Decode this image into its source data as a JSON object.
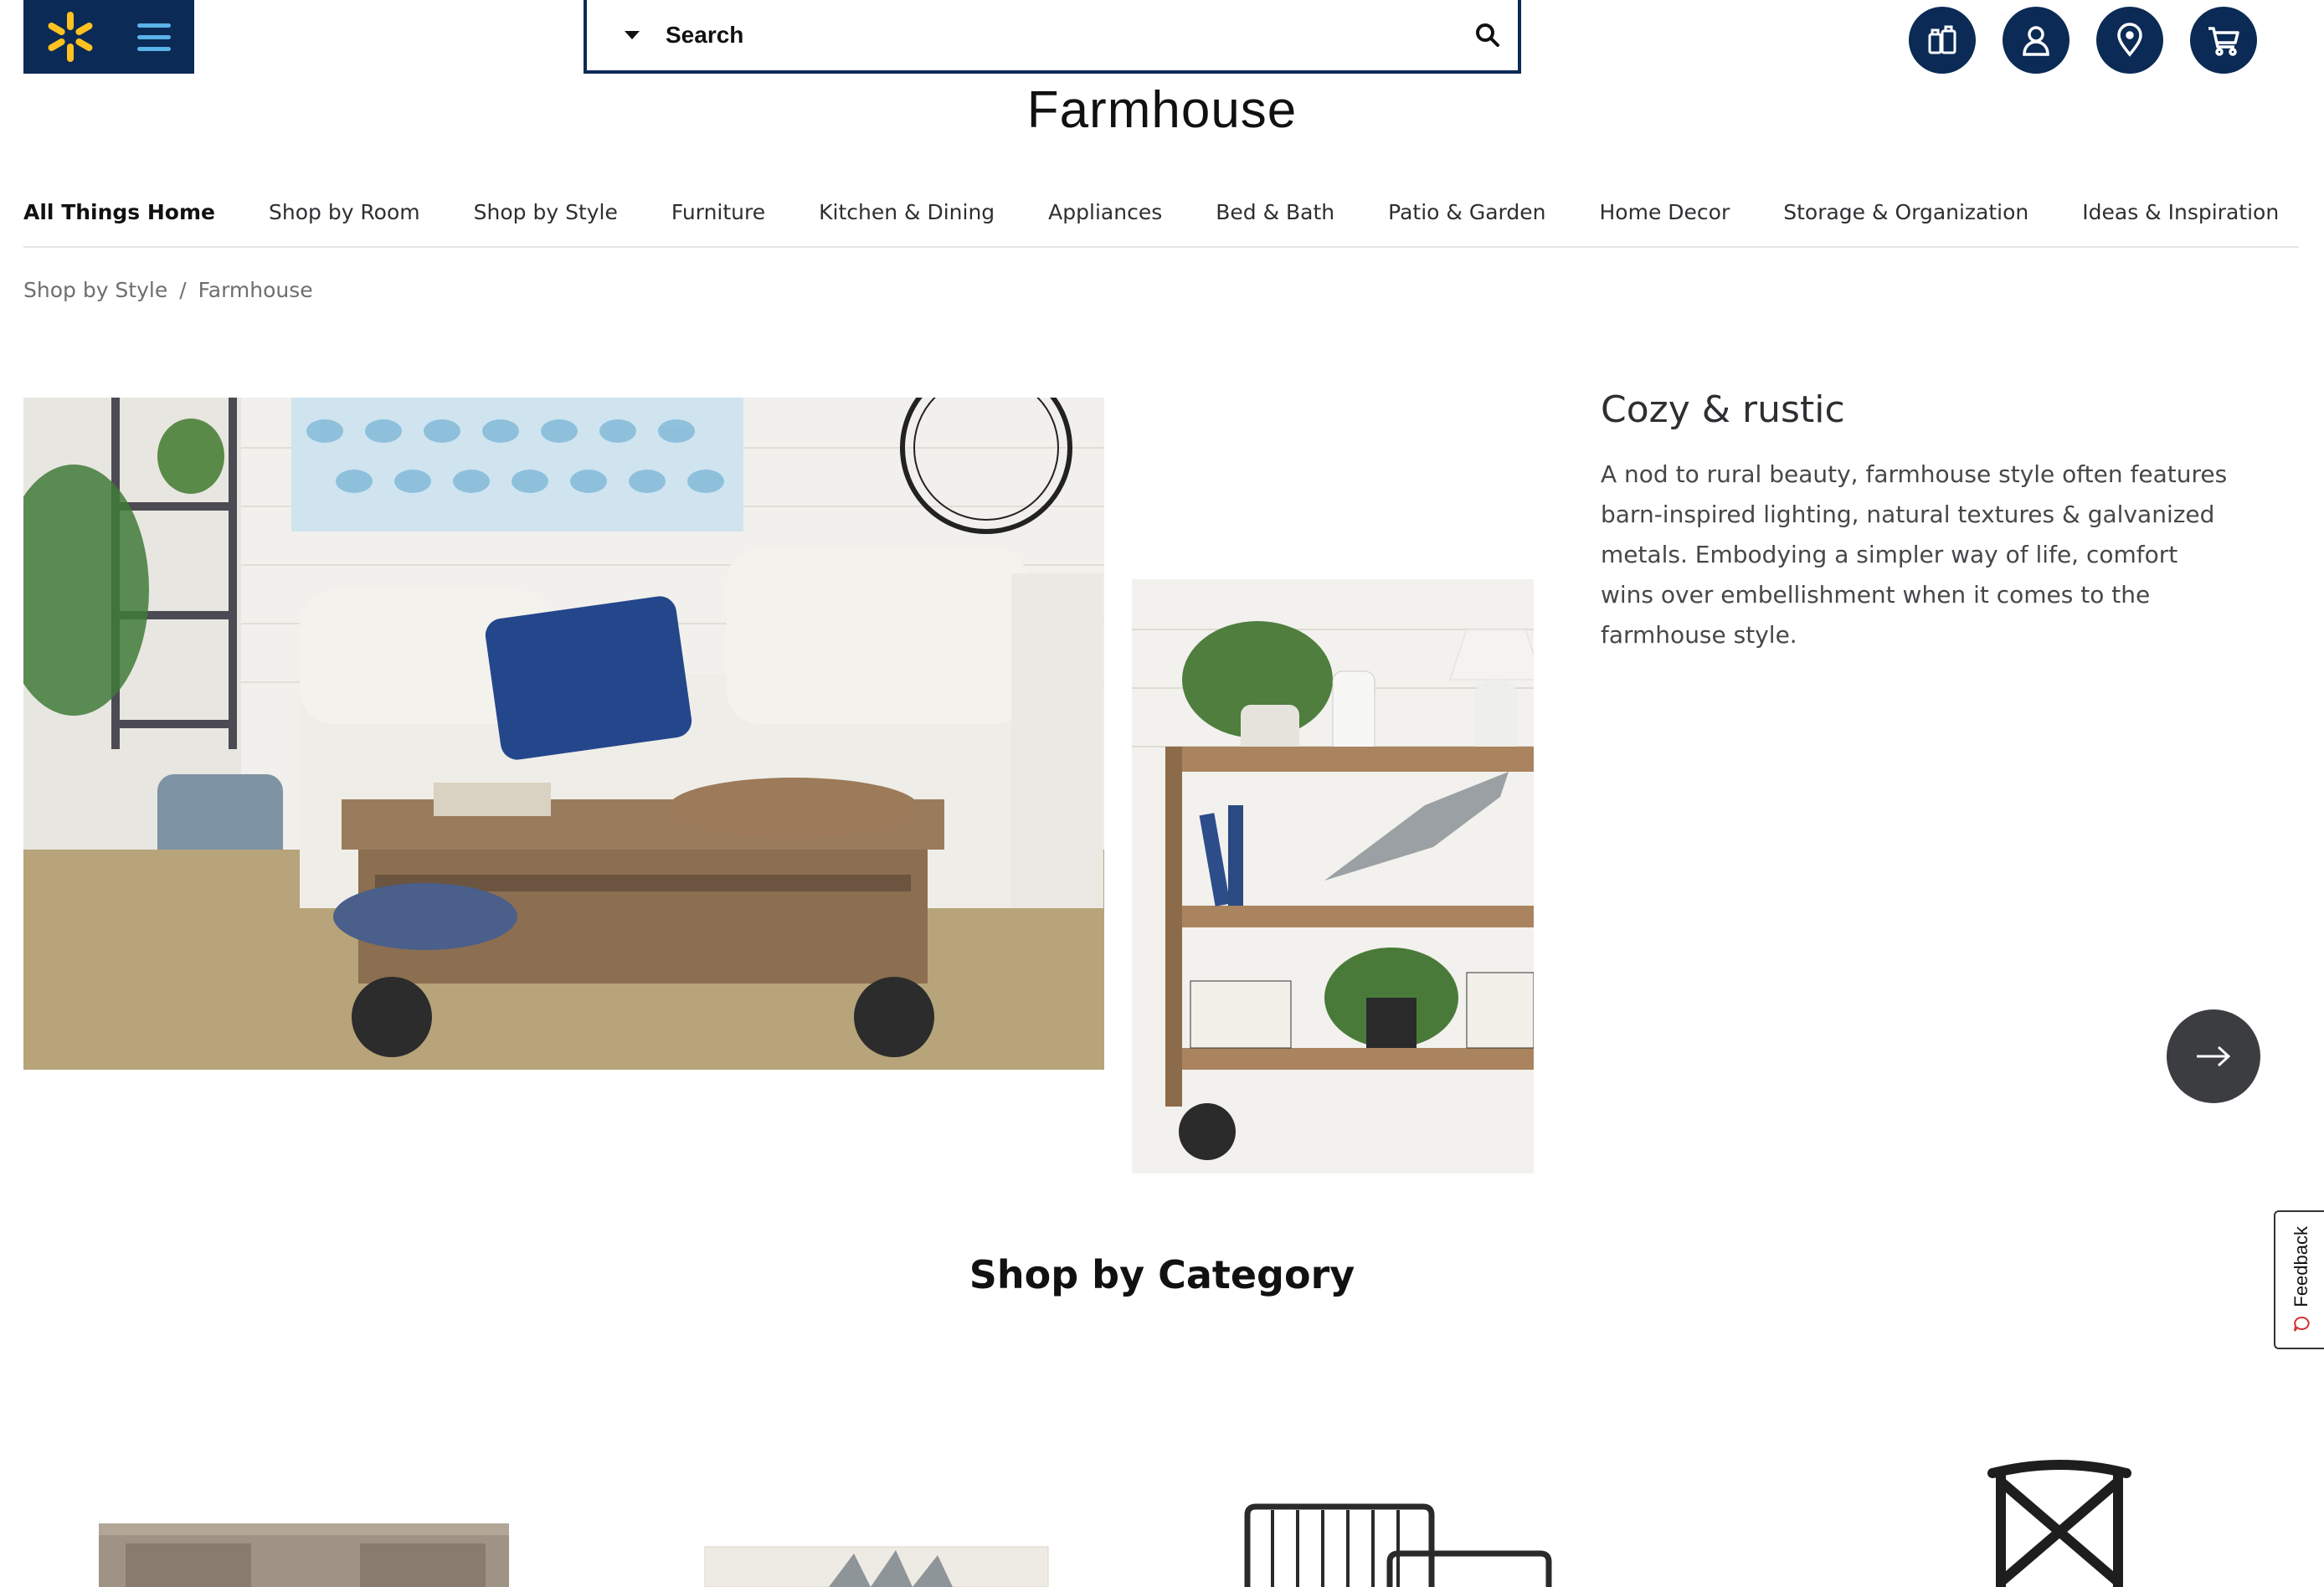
{
  "header": {
    "logo_alt": "Walmart",
    "menu_icon": "hamburger-menu-icon",
    "search": {
      "placeholder": "Search",
      "value": ""
    },
    "icons": [
      "reorder-icon",
      "account-icon",
      "location-pin-icon",
      "cart-icon"
    ],
    "colors": {
      "navy": "#0b2a55",
      "spark": "#ffc220",
      "menu": "#5ab3e8"
    }
  },
  "page": {
    "title": "Farmhouse"
  },
  "nav": {
    "items": [
      "All Things Home",
      "Shop by Room",
      "Shop by Style",
      "Furniture",
      "Kitchen & Dining",
      "Appliances",
      "Bed & Bath",
      "Patio & Garden",
      "Home Decor",
      "Storage & Organization",
      "Ideas & Inspiration"
    ]
  },
  "breadcrumb": {
    "parent": "Shop by Style",
    "separator": "/",
    "current": "Farmhouse"
  },
  "hero": {
    "heading": "Cozy & rustic",
    "body": "A nod to rural beauty, farmhouse style often features barn-inspired lighting, natural textures & galvanized metals. Embodying a simpler way of life, comfort wins over embellishment when it comes to the farmhouse style.",
    "main_image": "farmhouse-living-room-photo",
    "side_image": "farmhouse-shelf-cart-photo",
    "next_icon": "arrow-right-icon"
  },
  "feedback": {
    "label": "Feedback"
  },
  "categories": {
    "title": "Shop by Category",
    "items": [
      "tv-stand-image",
      "wall-decor-image",
      "metal-bed-image",
      "chair-image"
    ]
  }
}
